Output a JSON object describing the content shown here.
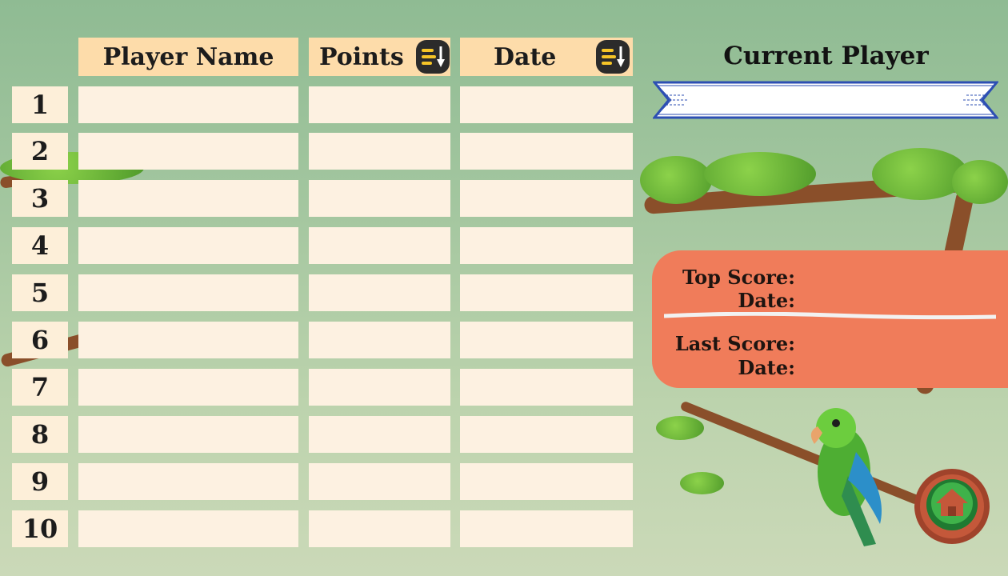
{
  "leaderboard": {
    "columns": {
      "player_name": "Player Name",
      "points": "Points",
      "date": "Date"
    },
    "ranks": [
      "1",
      "2",
      "3",
      "4",
      "5",
      "6",
      "7",
      "8",
      "9",
      "10"
    ]
  },
  "current_player": {
    "title": "Current Player",
    "name": ""
  },
  "score_card": {
    "top_score_label": "Top Score:",
    "top_date_label": "Date:",
    "last_score_label": "Last Score:",
    "last_date_label": "Date:"
  },
  "icons": {
    "sort_points": "sort-descending-icon",
    "sort_date": "sort-descending-icon",
    "home": "home-icon"
  },
  "colors": {
    "header_bg": "#fddcaa",
    "cell_bg": "#fdf1e1",
    "score_card_bg": "#f07c5a",
    "sort_accent": "#f5c427",
    "ribbon_border": "#2d4fb3"
  }
}
